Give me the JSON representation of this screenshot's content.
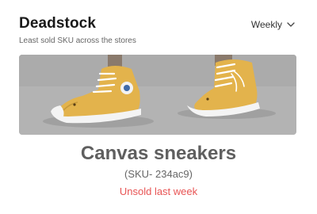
{
  "widget": {
    "title": "Deadstock",
    "subtitle": "Least sold SKU across the stores",
    "period": {
      "selected": "Weekly",
      "icon": "chevron-down-icon"
    }
  },
  "product": {
    "image": "canvas-sneakers-photo",
    "name": "Canvas sneakers",
    "sku": "(SKU- 234ac9)",
    "status": "Unsold last week"
  },
  "colors": {
    "status": "#e85454",
    "sneaker": "#e3b34c",
    "title": "#1a1a1a"
  }
}
